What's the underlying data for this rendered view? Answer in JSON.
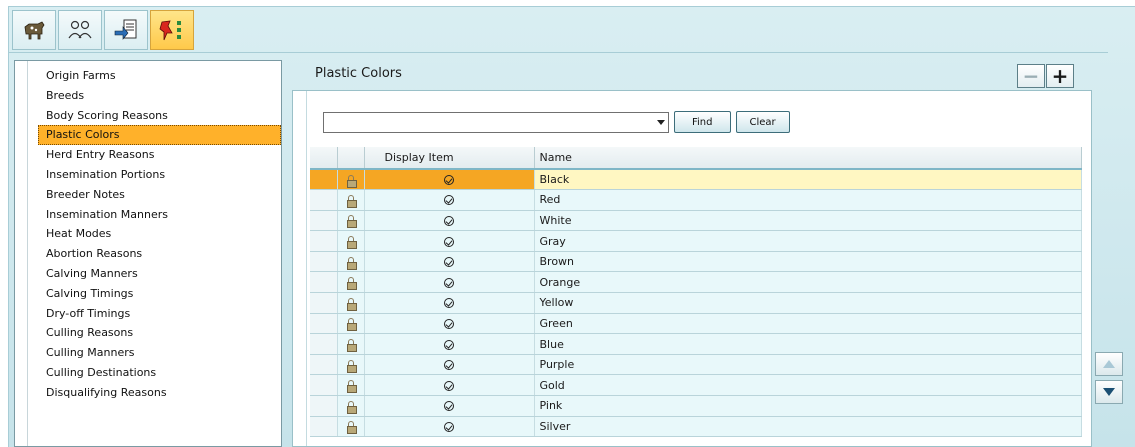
{
  "toolbar": {
    "buttons": [
      {
        "icon": "cow-icon",
        "active": false
      },
      {
        "icon": "people-icon",
        "active": false
      },
      {
        "icon": "import-icon",
        "active": false
      },
      {
        "icon": "pin-list-icon",
        "active": true
      }
    ]
  },
  "sidebar": {
    "items": [
      {
        "label": "Origin Farms"
      },
      {
        "label": "Breeds"
      },
      {
        "label": "Body Scoring Reasons"
      },
      {
        "label": "Plastic Colors",
        "selected": true
      },
      {
        "label": "Herd Entry Reasons"
      },
      {
        "label": "Insemination Portions"
      },
      {
        "label": "Breeder Notes"
      },
      {
        "label": "Insemination Manners"
      },
      {
        "label": "Heat Modes"
      },
      {
        "label": "Abortion Reasons"
      },
      {
        "label": "Calving Manners"
      },
      {
        "label": "Calving Timings"
      },
      {
        "label": "Dry-off Timings"
      },
      {
        "label": "Culling Reasons"
      },
      {
        "label": "Culling Manners"
      },
      {
        "label": "Culling Destinations"
      },
      {
        "label": "Disqualifying Reasons"
      }
    ]
  },
  "panel": {
    "title": "Plastic Colors",
    "minus_label": "−",
    "plus_label": "+"
  },
  "search": {
    "value": "",
    "find_label": "Find",
    "clear_label": "Clear"
  },
  "grid": {
    "columns": [
      "Display Item",
      "Name"
    ],
    "rows": [
      {
        "name": "Black",
        "selected": true
      },
      {
        "name": "Red"
      },
      {
        "name": "White"
      },
      {
        "name": "Gray"
      },
      {
        "name": "Brown"
      },
      {
        "name": "Orange"
      },
      {
        "name": "Yellow"
      },
      {
        "name": "Green"
      },
      {
        "name": "Blue"
      },
      {
        "name": "Purple"
      },
      {
        "name": "Gold"
      },
      {
        "name": "Pink"
      },
      {
        "name": "Silver"
      }
    ]
  },
  "colors": {
    "selection": "#ffb12a",
    "row_bg": "#e8f8fa",
    "selected_row": "#fff7c2"
  }
}
